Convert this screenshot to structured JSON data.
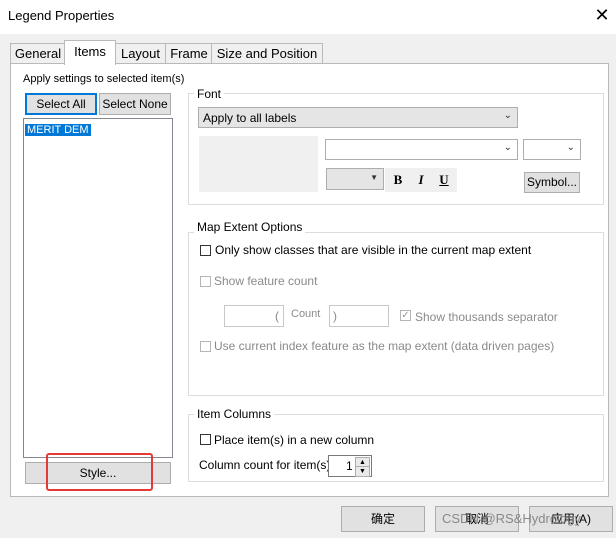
{
  "window": {
    "title": "Legend Properties"
  },
  "tabs": [
    {
      "label": "General",
      "active": false
    },
    {
      "label": "Items",
      "active": true
    },
    {
      "label": "Layout",
      "active": false
    },
    {
      "label": "Frame",
      "active": false
    },
    {
      "label": "Size and Position",
      "active": false
    }
  ],
  "items_panel": {
    "apply_label": "Apply settings to selected item(s)",
    "select_all_label": "Select All",
    "select_none_label": "Select None",
    "list_items": [
      "MERIT DEM"
    ],
    "style_button_label": "Style..."
  },
  "font": {
    "group_title": "Font",
    "apply_combo_value": "Apply to all labels",
    "font_name_value": "",
    "font_size_value": "",
    "color_value": "",
    "bold_label": "B",
    "italic_label": "I",
    "underline_label": "U",
    "symbol_button_label": "Symbol..."
  },
  "map_extent": {
    "group_title": "Map Extent Options",
    "only_show_label": "Only show classes that are visible in the current map extent",
    "show_feature_count_label": "Show feature count",
    "open_paren": "(",
    "count_label": "Count",
    "close_paren": ")",
    "thousands_label": "Show thousands separator",
    "use_index_label": "Use current index feature as the map extent (data driven pages)"
  },
  "item_columns": {
    "group_title": "Item Columns",
    "new_column_label": "Place item(s) in a new column",
    "column_count_label": "Column count for item(s)",
    "column_count_value": "1"
  },
  "footer": {
    "ok_label": "确定",
    "cancel_label": "取消",
    "apply_label": "应用(A)",
    "watermark": "CSDN @RS&Hydrology"
  },
  "colors": {
    "accent": "#0078d7",
    "highlight_box": "#e53935"
  }
}
